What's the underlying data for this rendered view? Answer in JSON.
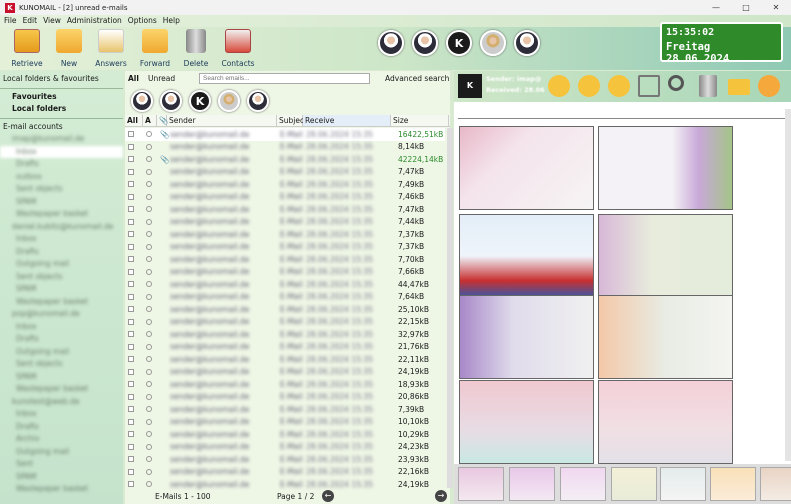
{
  "window": {
    "title": "KUNOMAIL - [2] unread e-mails",
    "app_icon": "K"
  },
  "menu": [
    "File",
    "Edit",
    "View",
    "Administration",
    "Options",
    "Help"
  ],
  "toolbar": [
    {
      "label": "Retrieve",
      "icon": "retrieve-icon"
    },
    {
      "label": "New",
      "icon": "new-mail-icon"
    },
    {
      "label": "Answers",
      "icon": "answer-icon"
    },
    {
      "label": "Forward",
      "icon": "forward-icon"
    },
    {
      "label": "Delete",
      "icon": "trash-icon"
    },
    {
      "label": "Contacts",
      "icon": "contacts-icon"
    }
  ],
  "clock": {
    "time": "15:35:02",
    "date": "Freitag  28.06.2024"
  },
  "sidebar": {
    "header": "Local folders & favourites",
    "favourites": "Favourites",
    "local_folders": "Local folders",
    "email_accounts": "E-mail accounts"
  },
  "list": {
    "tab_all": "All",
    "tab_unread": "Unread",
    "search_placeholder": "Search emails...",
    "advanced_search": "Advanced search",
    "columns": {
      "all": "All",
      "a": "A",
      "sender": "Sender",
      "subject": "Subjec",
      "receive": "Receive",
      "size": "Size"
    },
    "sizes": [
      "16422,51kB",
      "8,14kB",
      "42224,14kB",
      "7,47kB",
      "7,49kB",
      "7,46kB",
      "7,47kB",
      "7,44kB",
      "7,37kB",
      "7,37kB",
      "7,70kB",
      "7,66kB",
      "44,47kB",
      "7,64kB",
      "25,10kB",
      "22,15kB",
      "32,97kB",
      "21,76kB",
      "22,11kB",
      "24,19kB",
      "18,93kB",
      "20,86kB",
      "7,39kB",
      "10,10kB",
      "10,29kB",
      "24,23kB",
      "23,93kB",
      "22,16kB",
      "24,19kB"
    ],
    "footer_count": "E-Mails  1 - 100",
    "footer_page": "Page  1 / 2"
  }
}
